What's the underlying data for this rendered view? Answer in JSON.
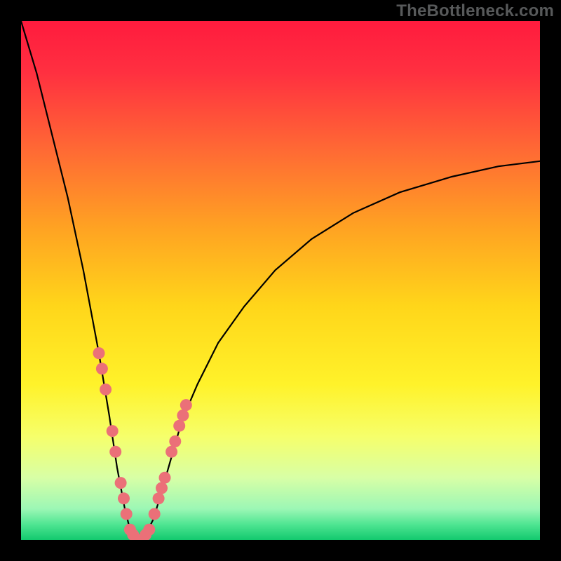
{
  "watermark": "TheBottleneck.com",
  "chart_data": {
    "type": "line",
    "title": "",
    "xlabel": "",
    "ylabel": "",
    "xlim": [
      0,
      100
    ],
    "ylim": [
      0,
      100
    ],
    "curve": {
      "name": "bottleneck-curve",
      "description": "V-shaped bottleneck percentage curve; minimum near x≈22, value≈0; rises toward 100 at x=0 and ≈70 at x=100",
      "points": [
        {
          "x": 0,
          "y": 100
        },
        {
          "x": 3,
          "y": 90
        },
        {
          "x": 6,
          "y": 78
        },
        {
          "x": 9,
          "y": 66
        },
        {
          "x": 12,
          "y": 52
        },
        {
          "x": 15,
          "y": 36
        },
        {
          "x": 17,
          "y": 24
        },
        {
          "x": 18.5,
          "y": 14
        },
        {
          "x": 20,
          "y": 6
        },
        {
          "x": 21,
          "y": 2
        },
        {
          "x": 22,
          "y": 0
        },
        {
          "x": 23,
          "y": 0
        },
        {
          "x": 24,
          "y": 1
        },
        {
          "x": 25.5,
          "y": 4
        },
        {
          "x": 27,
          "y": 9
        },
        {
          "x": 29,
          "y": 16
        },
        {
          "x": 31,
          "y": 23
        },
        {
          "x": 34,
          "y": 30
        },
        {
          "x": 38,
          "y": 38
        },
        {
          "x": 43,
          "y": 45
        },
        {
          "x": 49,
          "y": 52
        },
        {
          "x": 56,
          "y": 58
        },
        {
          "x": 64,
          "y": 63
        },
        {
          "x": 73,
          "y": 67
        },
        {
          "x": 83,
          "y": 70
        },
        {
          "x": 92,
          "y": 72
        },
        {
          "x": 100,
          "y": 73
        }
      ]
    },
    "markers": {
      "name": "highlight-dots",
      "color": "#eb7078",
      "points": [
        {
          "x": 15.0,
          "y": 36
        },
        {
          "x": 15.6,
          "y": 33
        },
        {
          "x": 16.3,
          "y": 29
        },
        {
          "x": 17.6,
          "y": 21
        },
        {
          "x": 18.2,
          "y": 17
        },
        {
          "x": 19.2,
          "y": 11
        },
        {
          "x": 19.8,
          "y": 8
        },
        {
          "x": 20.3,
          "y": 5
        },
        {
          "x": 21.0,
          "y": 2
        },
        {
          "x": 21.6,
          "y": 1
        },
        {
          "x": 22.3,
          "y": 0
        },
        {
          "x": 23.2,
          "y": 0
        },
        {
          "x": 24.0,
          "y": 1
        },
        {
          "x": 24.7,
          "y": 2
        },
        {
          "x": 25.7,
          "y": 5
        },
        {
          "x": 26.5,
          "y": 8
        },
        {
          "x": 27.1,
          "y": 10
        },
        {
          "x": 27.7,
          "y": 12
        },
        {
          "x": 29.0,
          "y": 17
        },
        {
          "x": 29.7,
          "y": 19
        },
        {
          "x": 30.5,
          "y": 22
        },
        {
          "x": 31.2,
          "y": 24
        },
        {
          "x": 31.8,
          "y": 26
        }
      ]
    },
    "background_gradient": {
      "stops": [
        {
          "offset": 0.0,
          "color": "#ff1b3e"
        },
        {
          "offset": 0.1,
          "color": "#ff3040"
        },
        {
          "offset": 0.25,
          "color": "#ff6a34"
        },
        {
          "offset": 0.4,
          "color": "#ffa322"
        },
        {
          "offset": 0.55,
          "color": "#ffd61a"
        },
        {
          "offset": 0.7,
          "color": "#fff22a"
        },
        {
          "offset": 0.8,
          "color": "#f6ff6a"
        },
        {
          "offset": 0.88,
          "color": "#d8ffa6"
        },
        {
          "offset": 0.94,
          "color": "#9cf7b5"
        },
        {
          "offset": 0.97,
          "color": "#4fe592"
        },
        {
          "offset": 1.0,
          "color": "#12c96e"
        }
      ]
    }
  }
}
